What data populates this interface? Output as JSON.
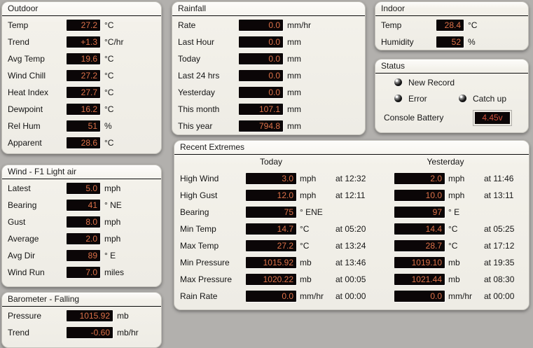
{
  "colors": {
    "page_bg": "#b2b0ad",
    "panel_bg": "#f1efe8",
    "display_bg": "#0b0607",
    "display_text": "#dd7148",
    "battery_text": "#d2503e"
  },
  "panels": {
    "outdoor": {
      "title": "Outdoor",
      "rows": [
        {
          "label": "Temp",
          "value": "27.2",
          "unit": "°C"
        },
        {
          "label": "Trend",
          "value": "+1.3",
          "unit": "°C/hr"
        },
        {
          "label": "Avg Temp",
          "value": "19.6",
          "unit": "°C"
        },
        {
          "label": "Wind Chill",
          "value": "27.2",
          "unit": "°C"
        },
        {
          "label": "Heat Index",
          "value": "27.7",
          "unit": "°C"
        },
        {
          "label": "Dewpoint",
          "value": "16.2",
          "unit": "°C"
        },
        {
          "label": "Rel Hum",
          "value": "51",
          "unit": "%"
        },
        {
          "label": "Apparent",
          "value": "28.6",
          "unit": "°C"
        }
      ]
    },
    "wind": {
      "title": "Wind - F1 Light air",
      "rows": [
        {
          "label": "Latest",
          "value": "5.0",
          "unit": "mph"
        },
        {
          "label": "Bearing",
          "value": "41",
          "unit": "° NE"
        },
        {
          "label": "Gust",
          "value": "8.0",
          "unit": "mph"
        },
        {
          "label": "Average",
          "value": "2.0",
          "unit": "mph"
        },
        {
          "label": "Avg Dir",
          "value": "89",
          "unit": "° E"
        },
        {
          "label": "Wind Run",
          "value": "7.0",
          "unit": "miles"
        }
      ]
    },
    "barometer": {
      "title": "Barometer - Falling",
      "rows": [
        {
          "label": "Pressure",
          "value": "1015.92",
          "unit": "mb"
        },
        {
          "label": "Trend",
          "value": "-0.60",
          "unit": "mb/hr"
        }
      ]
    },
    "rainfall": {
      "title": "Rainfall",
      "rows": [
        {
          "label": "Rate",
          "value": "0.0",
          "unit": "mm/hr"
        },
        {
          "label": "Last Hour",
          "value": "0.0",
          "unit": "mm"
        },
        {
          "label": "Today",
          "value": "0.0",
          "unit": "mm"
        },
        {
          "label": "Last 24 hrs",
          "value": "0.0",
          "unit": "mm"
        },
        {
          "label": "Yesterday",
          "value": "0.0",
          "unit": "mm"
        },
        {
          "label": "This month",
          "value": "107.1",
          "unit": "mm"
        },
        {
          "label": "This year",
          "value": "794.8",
          "unit": "mm"
        }
      ]
    },
    "indoor": {
      "title": "Indoor",
      "rows": [
        {
          "label": "Temp",
          "value": "28.4",
          "unit": "°C"
        },
        {
          "label": "Humidity",
          "value": "52",
          "unit": "%"
        }
      ]
    },
    "status": {
      "title": "Status",
      "leds": [
        {
          "label": "New Record"
        },
        {
          "label": "Error"
        },
        {
          "label": "Catch up"
        }
      ],
      "battery": {
        "label": "Console Battery",
        "value": "4.45v"
      }
    },
    "extremes": {
      "title": "Recent Extremes",
      "columns": {
        "today": "Today",
        "yesterday": "Yesterday"
      },
      "rows": [
        {
          "label": "High Wind",
          "today": {
            "value": "3.0",
            "unit": "mph",
            "time": "at 12:32"
          },
          "yesterday": {
            "value": "2.0",
            "unit": "mph",
            "time": "at 11:46"
          }
        },
        {
          "label": "High Gust",
          "today": {
            "value": "12.0",
            "unit": "mph",
            "time": "at 12:11"
          },
          "yesterday": {
            "value": "10.0",
            "unit": "mph",
            "time": "at 13:11"
          }
        },
        {
          "label": "Bearing",
          "today": {
            "value": "75",
            "unit": "° ENE",
            "time": ""
          },
          "yesterday": {
            "value": "97",
            "unit": "° E",
            "time": ""
          }
        },
        {
          "label": "Min Temp",
          "today": {
            "value": "14.7",
            "unit": "°C",
            "time": "at 05:20"
          },
          "yesterday": {
            "value": "14.4",
            "unit": "°C",
            "time": "at 05:25"
          }
        },
        {
          "label": "Max Temp",
          "today": {
            "value": "27.2",
            "unit": "°C",
            "time": "at 13:24"
          },
          "yesterday": {
            "value": "28.7",
            "unit": "°C",
            "time": "at 17:12"
          }
        },
        {
          "label": "Min Pressure",
          "today": {
            "value": "1015.92",
            "unit": "mb",
            "time": "at 13:46"
          },
          "yesterday": {
            "value": "1019.10",
            "unit": "mb",
            "time": "at 19:35"
          }
        },
        {
          "label": "Max Pressure",
          "today": {
            "value": "1020.22",
            "unit": "mb",
            "time": "at 00:05"
          },
          "yesterday": {
            "value": "1021.44",
            "unit": "mb",
            "time": "at 08:30"
          }
        },
        {
          "label": "Rain Rate",
          "today": {
            "value": "0.0",
            "unit": "mm/hr",
            "time": "at 00:00"
          },
          "yesterday": {
            "value": "0.0",
            "unit": "mm/hr",
            "time": "at 00:00"
          }
        }
      ]
    }
  }
}
